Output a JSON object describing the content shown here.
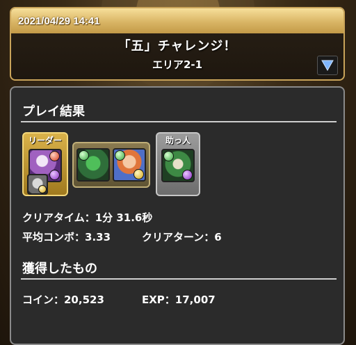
{
  "header": {
    "datetime": "2021/04/29 14:41",
    "dungeon_name": "「五」チャレンジ！",
    "floor_name": "エリア2-1",
    "expand_icon": "triangle-down-icon"
  },
  "result": {
    "section_title": "プレイ結果",
    "leader_label": "リーダー",
    "helper_label": "助っ人",
    "clear_time": "クリアタイム：1分 31.6秒",
    "avg_combo": "平均コンボ：3.33",
    "clear_turns": "クリアターン：6"
  },
  "rewards": {
    "section_title": "獲得したもの",
    "coins": "コイン：20,523",
    "exp": "EXP：17,007"
  },
  "colors": {
    "header_gold": "#d9b565",
    "panel_bg": "#2b2b2b",
    "leader_gold": "#d9b24a",
    "helper_gray": "#9c9c9c"
  }
}
